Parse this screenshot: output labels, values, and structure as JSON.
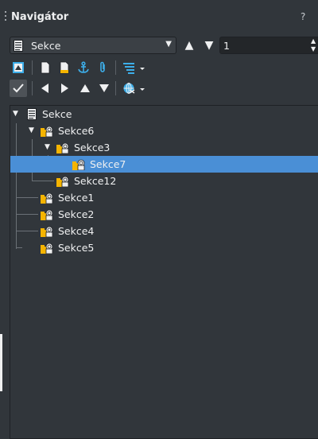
{
  "window": {
    "title": "Navigátor",
    "help": "?"
  },
  "navigator": {
    "type_select": "Sekce",
    "page_number": "1"
  },
  "tree": {
    "root": "Sekce",
    "items": [
      {
        "label": "Sekce6",
        "expanded": true
      },
      {
        "label": "Sekce3",
        "expanded": true
      },
      {
        "label": "Sekce7",
        "selected": true
      },
      {
        "label": "Sekce12"
      },
      {
        "label": "Sekce1"
      },
      {
        "label": "Sekce2"
      },
      {
        "label": "Sekce4"
      },
      {
        "label": "Sekce5"
      }
    ]
  },
  "colors": {
    "background": "#31363b",
    "selection": "#4a8fd6",
    "icon_yellow": "#f5b400",
    "icon_blue": "#3daee9"
  }
}
